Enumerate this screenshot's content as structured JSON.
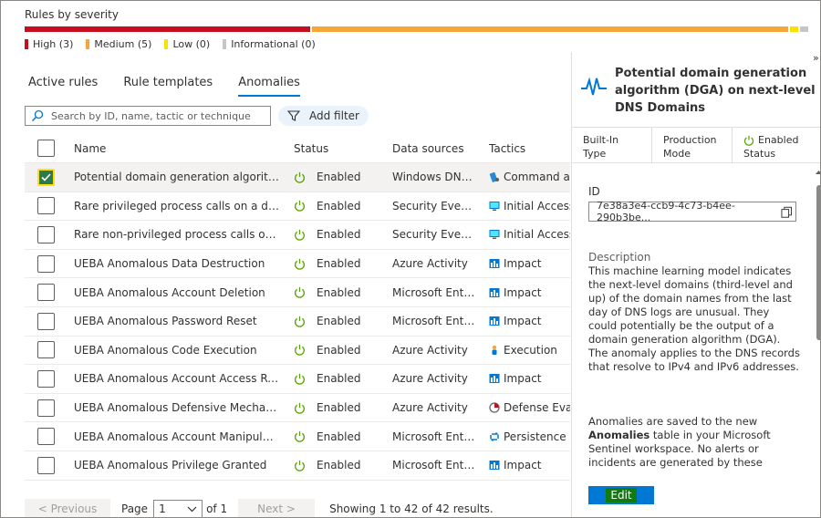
{
  "severity": {
    "title": "Rules by severity",
    "segments": [
      {
        "label": "High (3)",
        "color": "#c50f1f",
        "count": 3
      },
      {
        "label": "Medium (5)",
        "color": "#f7a738",
        "count": 5
      },
      {
        "label": "Low (0)",
        "color": "#fce100",
        "count": 0
      },
      {
        "label": "Informational (0)",
        "color": "#c8c6c4",
        "count": 0
      }
    ]
  },
  "tabs": [
    {
      "label": "Active rules",
      "active": false
    },
    {
      "label": "Rule templates",
      "active": false
    },
    {
      "label": "Anomalies",
      "active": true
    }
  ],
  "search": {
    "placeholder": "Search by ID, name, tactic or technique"
  },
  "filter": {
    "label": "Add filter"
  },
  "table": {
    "columns": [
      "Name",
      "Status",
      "Data sources",
      "Tactics"
    ],
    "rows": [
      {
        "name": "Potential domain generation algorithm (DGA) on next-level DNS Domains",
        "status": "Enabled",
        "source": "Windows DNS Events",
        "tactic": "Command and Control",
        "tactic_icon": "command-icon",
        "selected": true
      },
      {
        "name": "Rare privileged process calls on a daily basis",
        "status": "Enabled",
        "source": "Security Events (Windows)",
        "tactic": "Initial Access",
        "tactic_icon": "initial-access-icon",
        "selected": false
      },
      {
        "name": "Rare non-privileged process calls on a daily basis",
        "status": "Enabled",
        "source": "Security Events (Windows)",
        "tactic": "Initial Access",
        "tactic_icon": "initial-access-icon",
        "selected": false
      },
      {
        "name": "UEBA Anomalous Data Destruction",
        "status": "Enabled",
        "source": "Azure Activity",
        "tactic": "Impact",
        "tactic_icon": "impact-icon",
        "selected": false
      },
      {
        "name": "UEBA Anomalous Account Deletion",
        "status": "Enabled",
        "source": "Microsoft Entra ID",
        "tactic": "Impact",
        "tactic_icon": "impact-icon",
        "selected": false
      },
      {
        "name": "UEBA Anomalous Password Reset",
        "status": "Enabled",
        "source": "Microsoft Entra ID",
        "tactic": "Impact",
        "tactic_icon": "impact-icon",
        "selected": false
      },
      {
        "name": "UEBA Anomalous Code Execution",
        "status": "Enabled",
        "source": "Azure Activity",
        "tactic": "Execution",
        "tactic_icon": "execution-icon",
        "selected": false
      },
      {
        "name": "UEBA Anomalous Account Access Removal",
        "status": "Enabled",
        "source": "Azure Activity",
        "tactic": "Impact",
        "tactic_icon": "impact-icon",
        "selected": false
      },
      {
        "name": "UEBA Anomalous Defensive Mechanism Modification",
        "status": "Enabled",
        "source": "Azure Activity",
        "tactic": "Defense Evasion",
        "tactic_icon": "defense-evasion-icon",
        "selected": false
      },
      {
        "name": "UEBA Anomalous Account Manipulation",
        "status": "Enabled",
        "source": "Microsoft Entra ID",
        "tactic": "Persistence",
        "tactic_icon": "persistence-icon",
        "selected": false
      },
      {
        "name": "UEBA Anomalous Privilege Granted",
        "status": "Enabled",
        "source": "Microsoft Entra ID",
        "tactic": "Impact",
        "tactic_icon": "impact-icon",
        "selected": false
      }
    ]
  },
  "pager": {
    "previous": "< Previous",
    "page_label": "Page",
    "page_value": "1",
    "of_label": "of 1",
    "next": "Next >",
    "summary": "Showing 1 to 42 of 42 results."
  },
  "details": {
    "expand": "»",
    "title": "Potential domain generation algorithm (DGA) on next-level DNS Domains",
    "meta": [
      {
        "line1": "Built-In",
        "line2": "Type"
      },
      {
        "line1": "Production",
        "line2": "Mode"
      },
      {
        "line1": "Enabled",
        "line2": "Status"
      }
    ],
    "id_label": "ID",
    "id_value": "7e38a3e4-ccb9-4c73-b4ee-290b3be...",
    "description_label": "Description",
    "description": "This machine learning model indicates the next-level domains (third-level and up) of the domain names from the last day of DNS logs are unusual. They could potentially be the output of a domain generation algorithm (DGA). The anomaly applies to the DNS records that resolve to IPv4 and IPv6 addresses.",
    "note_before": "Anomalies are saved to the new ",
    "note_bold": "Anomalies",
    "note_after": " table in your Microsoft Sentinel workspace. No alerts or incidents are generated by these anomalies. Use these anomalies to",
    "edit_label": "Edit"
  }
}
